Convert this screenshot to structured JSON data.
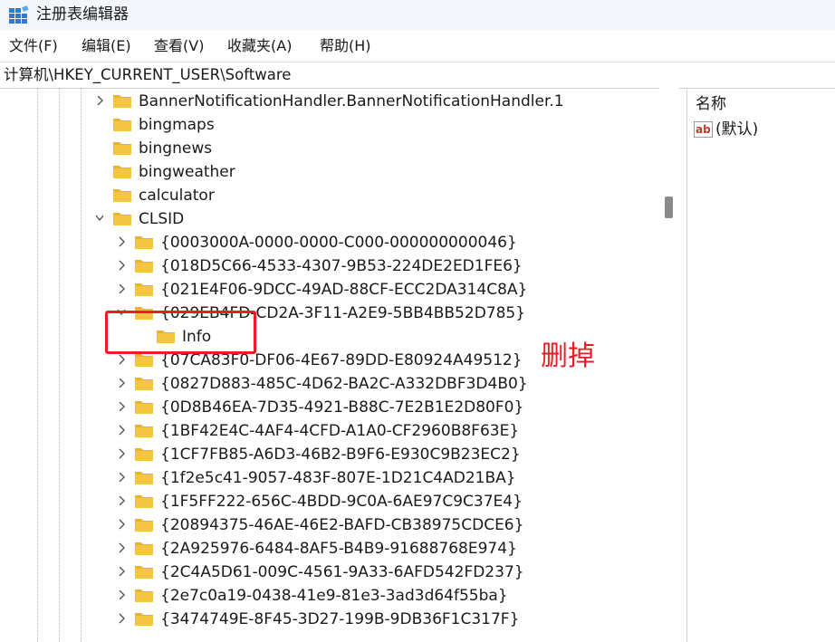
{
  "window": {
    "title": "注册表编辑器"
  },
  "menu": [
    "文件(F)",
    "编辑(E)",
    "查看(V)",
    "收藏夹(A)",
    "帮助(H)"
  ],
  "address": "计算机\\HKEY_CURRENT_USER\\Software",
  "tree": [
    {
      "label": "BannerNotificationHandler.BannerNotificationHandler.1",
      "level": 1,
      "expander": "collapsed"
    },
    {
      "label": "bingmaps",
      "level": 1,
      "expander": "none"
    },
    {
      "label": "bingnews",
      "level": 1,
      "expander": "none"
    },
    {
      "label": "bingweather",
      "level": 1,
      "expander": "none"
    },
    {
      "label": "calculator",
      "level": 1,
      "expander": "none"
    },
    {
      "label": "CLSID",
      "level": 1,
      "expander": "expanded"
    },
    {
      "label": "{0003000A-0000-0000-C000-000000000046}",
      "level": 2,
      "expander": "collapsed"
    },
    {
      "label": "{018D5C66-4533-4307-9B53-224DE2ED1FE6}",
      "level": 2,
      "expander": "collapsed"
    },
    {
      "label": "{021E4F06-9DCC-49AD-88CF-ECC2DA314C8A}",
      "level": 2,
      "expander": "collapsed"
    },
    {
      "label": "{029EB4FD-CD2A-3F11-A2E9-5BB4BB52D785}",
      "level": 2,
      "expander": "expanded"
    },
    {
      "label": "Info",
      "level": 3,
      "expander": "none"
    },
    {
      "label": "{07CA83F0-DF06-4E67-89DD-E80924A49512}",
      "level": 2,
      "expander": "collapsed"
    },
    {
      "label": "{0827D883-485C-4D62-BA2C-A332DBF3D4B0}",
      "level": 2,
      "expander": "collapsed"
    },
    {
      "label": "{0D8B46EA-7D35-4921-B88C-7E2B1E2D80F0}",
      "level": 2,
      "expander": "collapsed"
    },
    {
      "label": "{1BF42E4C-4AF4-4CFD-A1A0-CF2960B8F63E}",
      "level": 2,
      "expander": "collapsed"
    },
    {
      "label": "{1CF7FB85-A6D3-46B2-B9F6-E930C9B23EC2}",
      "level": 2,
      "expander": "collapsed"
    },
    {
      "label": "{1f2e5c41-9057-483F-807E-1D21C4AD21BA}",
      "level": 2,
      "expander": "collapsed"
    },
    {
      "label": "{1F5FF222-656C-4BDD-9C0A-6AE97C9C37E4}",
      "level": 2,
      "expander": "collapsed"
    },
    {
      "label": "{20894375-46AE-46E2-BAFD-CB38975CDCE6}",
      "level": 2,
      "expander": "collapsed"
    },
    {
      "label": "{2A925976-6484-8AF5-B4B9-91688768E974}",
      "level": 2,
      "expander": "collapsed"
    },
    {
      "label": "{2C4A5D61-009C-4561-9A33-6AFD542FD237}",
      "level": 2,
      "expander": "collapsed"
    },
    {
      "label": "{2e7c0a19-0438-41e9-81e3-3ad3d64f55ba}",
      "level": 2,
      "expander": "collapsed"
    },
    {
      "label": "{3474749E-8F45-3D27-199B-9DB36F1C317F}",
      "level": 2,
      "expander": "collapsed"
    }
  ],
  "values_pane": {
    "column_name": "名称",
    "items": [
      {
        "name": "(默认)",
        "icon": "string-value-icon"
      }
    ]
  },
  "annotation": {
    "text": "删掉",
    "color": "#ec1c24"
  },
  "colors": {
    "folder": "#f4c542",
    "titlebar": "#f3f6fb"
  }
}
